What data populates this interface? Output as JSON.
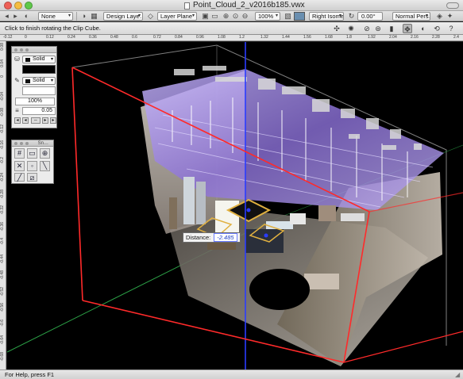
{
  "window": {
    "title": "Point_Cloud_2_v2016b185.vwx"
  },
  "view_bar": {
    "class_value": "None",
    "design_layer_label": "Design Laye…",
    "layer_plane_label": "Layer Plane",
    "zoom_value": "100%",
    "view_value": "Right Isome…",
    "rotation_value": "0.00°",
    "projection_value": "Normal Pers…"
  },
  "mode_bar": {
    "hint": "Click to finish rotating the Clip Cube."
  },
  "rulers": {
    "top_labels": [
      "-0.12",
      "0",
      "0.12",
      "0.24",
      "0.36",
      "0.48",
      "0.6",
      "0.72",
      "0.84",
      "0.96",
      "1.08",
      "1.2",
      "1.32",
      "1.44",
      "1.56",
      "1.68",
      "1.8",
      "1.92",
      "2.04",
      "2.16",
      "2.28",
      "2.4"
    ],
    "left_labels": [
      "0.08",
      "0.04",
      "0",
      "-0.04",
      "-0.08",
      "-0.12",
      "-0.16",
      "-0.2",
      "-0.24",
      "-0.28",
      "-0.32",
      "-0.36",
      "-0.4",
      "-0.44",
      "-0.48",
      "-0.52",
      "-0.56",
      "-0.6",
      "-0.64",
      "-0.68"
    ]
  },
  "attributes_palette": {
    "fill_style": "Solid",
    "pen_style": "Solid",
    "opacity": "100%",
    "line_weight": "0.05"
  },
  "snapping_palette": {
    "title": "Sn…"
  },
  "measurement": {
    "label": "Distance:",
    "value": "-2.485"
  },
  "status_bar": {
    "text": "For Help, press F1"
  },
  "colors": {
    "clip_cube": "#ff2a2a",
    "z_axis": "#2a3cff",
    "y_axis": "#2ea84a",
    "canvas_bg": "#000000",
    "point_cloud_tint": "#b48cff"
  }
}
